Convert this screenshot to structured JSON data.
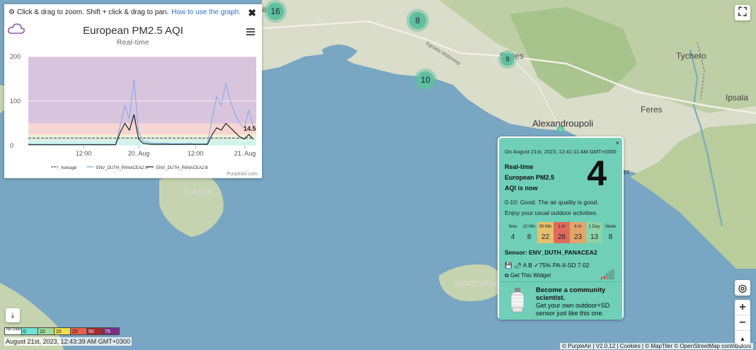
{
  "map": {
    "labels": {
      "kanthi": "anthi",
      "sapes": "Sapes",
      "tychero": "Tychero",
      "ipsala": "Ipsala",
      "feres": "Feres",
      "alexandroupoli": "Alexandroupoli",
      "egnatia": "Egnatia Motorway",
      "thasos": "THASOS",
      "samothraki": "SAMOTHRAKI",
      "edge_e": "ez"
    },
    "clusters": {
      "c1": "16",
      "c2": "8",
      "c3": "9",
      "c4": "10"
    }
  },
  "chart_panel": {
    "help_text": "Click & drag to zoom. Shift + click & drag to pan.",
    "help_link": "How to use the graph.",
    "close": "✖",
    "title": "European PM2.5 AQI",
    "subtitle": "Real-time",
    "credit": "PurpleAir.com"
  },
  "chart_data": {
    "type": "line",
    "title": "European PM2.5 AQI",
    "subtitle": "Real-time",
    "ylim": [
      0,
      200
    ],
    "y_ticks": [
      "0",
      "100",
      "200"
    ],
    "x_ticks": [
      "12:00",
      "20. Aug",
      "12:00",
      "21. Aug"
    ],
    "last_value_label": "14.5",
    "bands": [
      {
        "from": 0,
        "to": 10,
        "color": "#cdf3ec"
      },
      {
        "from": 10,
        "to": 20,
        "color": "#dcefe2"
      },
      {
        "from": 20,
        "to": 25,
        "color": "#f4eed0"
      },
      {
        "from": 25,
        "to": 50,
        "color": "#f6d6d2"
      },
      {
        "from": 50,
        "to": 200,
        "color": "#d9c4de"
      }
    ],
    "series": [
      {
        "name": "Average",
        "color": "#555555",
        "dashed": true,
        "values": [
          17,
          17,
          17,
          17,
          17,
          17,
          17,
          17,
          17,
          17,
          17,
          17,
          17,
          17,
          17,
          17,
          17,
          17,
          17,
          17,
          17,
          17,
          17,
          17,
          17,
          17,
          17,
          17,
          17,
          17,
          17,
          17,
          17,
          17,
          17,
          17,
          17,
          17,
          17,
          17,
          17,
          17,
          17,
          17,
          17,
          17,
          17,
          17,
          17,
          17
        ]
      },
      {
        "name": "ENV_DUTH_PANACEA2 A",
        "color": "#7fa8e8",
        "values": [
          4,
          3,
          3,
          3,
          3,
          3,
          3,
          3,
          3,
          3,
          3,
          3,
          3,
          3,
          3,
          3,
          3,
          3,
          3,
          3,
          45,
          90,
          60,
          150,
          30,
          10,
          8,
          6,
          5,
          5,
          5,
          4,
          4,
          4,
          4,
          5,
          4,
          4,
          4,
          4,
          60,
          110,
          90,
          140,
          100,
          70,
          50,
          40,
          80,
          40
        ]
      },
      {
        "name": "ENV_DUTH_PANACEA2 B",
        "color": "#222222",
        "values": [
          2,
          2,
          2,
          2,
          2,
          2,
          2,
          2,
          2,
          2,
          2,
          2,
          2,
          2,
          2,
          2,
          2,
          2,
          2,
          2,
          30,
          50,
          35,
          70,
          15,
          5,
          4,
          3,
          3,
          3,
          3,
          3,
          3,
          3,
          3,
          3,
          3,
          3,
          3,
          3,
          25,
          40,
          35,
          50,
          40,
          30,
          20,
          15,
          25,
          14.5
        ]
      }
    ]
  },
  "popup": {
    "close": "×",
    "date": "On August 21st, 2023, 12:41:11 AM GMT+0300",
    "realtime_lines": [
      "Real-time",
      "European PM2.5",
      "AQI is now"
    ],
    "value": "4",
    "description_lines": [
      "0-10: Good. The air quality is good.",
      "Enjoy your usual outdoor activities."
    ],
    "averages": [
      {
        "label": "Now",
        "value": "4",
        "color": "#6fcfb7"
      },
      {
        "label": "10 Min",
        "value": "8",
        "color": "#6fcfb7"
      },
      {
        "label": "30 Min",
        "value": "22",
        "color": "#e5c06e"
      },
      {
        "label": "1 hr",
        "value": "28",
        "color": "#e06a5b"
      },
      {
        "label": "6 hr",
        "value": "23",
        "color": "#e5a36a"
      },
      {
        "label": "1 Day",
        "value": "13",
        "color": "#8fd3a8"
      },
      {
        "label": "Week",
        "value": "8",
        "color": "#6fcfb7"
      }
    ],
    "sensor": "Sensor: ENV_DUTH_PANACEA2",
    "details": "💾 🌶 A B ✓75% PA-II-SD 7.02",
    "widget": "Get This Widget",
    "community_title": "Become a community scientist.",
    "community_body": "Get your own outdoor+SD sensor just like this one."
  },
  "legend": {
    "items": [
      {
        "label": "No Data",
        "color": "#ffffff"
      },
      {
        "label": "0",
        "color": "#6fe3d6"
      },
      {
        "label": "10",
        "color": "#9fdc9c"
      },
      {
        "label": "20",
        "color": "#f0e050"
      },
      {
        "label": "25",
        "color": "#e8604e"
      },
      {
        "label": "50",
        "color": "#a02c30"
      },
      {
        "label": "75",
        "color": "#7a2f82"
      }
    ]
  },
  "map_date": "August 21st, 2023, 12:43:39 AM GMT+0300",
  "attribution": "© PurpleAir | V2.0.12 | Cookies | © MapTiler © OpenStreetMap contributors",
  "controls": {
    "fullscreen": "⛶",
    "locate": "◎",
    "zoom_in": "+",
    "zoom_out": "−",
    "compass": "▲",
    "download": "⤓"
  }
}
